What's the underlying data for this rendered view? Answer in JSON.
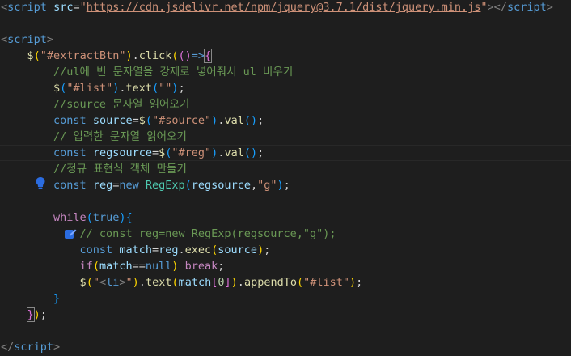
{
  "editor": {
    "theme_colors": {
      "background": "#1e1e1e",
      "keyword": "#569cd6",
      "string": "#ce9178",
      "comment": "#6a9955",
      "function": "#dcdcaa",
      "variable": "#9cdcfe",
      "control": "#c586c0",
      "class": "#4ec9b0"
    },
    "icons": [
      "lightbulb-icon",
      "edit-hint-icon"
    ],
    "lines": [
      [
        {
          "c": "t-punc",
          "t": "<"
        },
        {
          "c": "t-tag",
          "t": "script"
        },
        {
          "c": "t-plain",
          "t": " "
        },
        {
          "c": "t-attr",
          "t": "src"
        },
        {
          "c": "t-plain",
          "t": "="
        },
        {
          "c": "t-str",
          "t": "\""
        },
        {
          "c": "t-url",
          "t": "https://cdn.jsdelivr.net/npm/jquery@3.7.1/dist/jquery.min.js"
        },
        {
          "c": "t-str",
          "t": "\""
        },
        {
          "c": "t-punc",
          "t": "></"
        },
        {
          "c": "t-tag",
          "t": "script"
        },
        {
          "c": "t-punc",
          "t": ">"
        }
      ],
      [],
      [
        {
          "c": "t-punc",
          "t": "<"
        },
        {
          "c": "t-tag",
          "t": "script"
        },
        {
          "c": "t-punc",
          "t": ">"
        }
      ],
      [
        {
          "c": "t-plain",
          "t": "    "
        },
        {
          "c": "t-fn",
          "t": "$"
        },
        {
          "c": "t-b1",
          "t": "("
        },
        {
          "c": "t-str",
          "t": "\"#extractBtn\""
        },
        {
          "c": "t-b1",
          "t": ")"
        },
        {
          "c": "t-plain",
          "t": "."
        },
        {
          "c": "t-fn",
          "t": "click"
        },
        {
          "c": "t-b1",
          "t": "("
        },
        {
          "c": "t-b2",
          "t": "()"
        },
        {
          "c": "t-kw",
          "t": "=>"
        },
        {
          "c": "t-b2 bm",
          "t": "{"
        }
      ],
      [
        {
          "c": "t-plain",
          "t": "        "
        },
        {
          "c": "t-cmt",
          "t": "//ul에 빈 문자열을 강제로 넣어줘서 ul 비우기"
        }
      ],
      [
        {
          "c": "t-plain",
          "t": "        "
        },
        {
          "c": "t-fn",
          "t": "$"
        },
        {
          "c": "t-b3",
          "t": "("
        },
        {
          "c": "t-str",
          "t": "\"#list\""
        },
        {
          "c": "t-b3",
          "t": ")"
        },
        {
          "c": "t-plain",
          "t": "."
        },
        {
          "c": "t-fn",
          "t": "text"
        },
        {
          "c": "t-b3",
          "t": "("
        },
        {
          "c": "t-str",
          "t": "\"\""
        },
        {
          "c": "t-b3",
          "t": ")"
        },
        {
          "c": "t-plain",
          "t": ";"
        }
      ],
      [
        {
          "c": "t-plain",
          "t": "        "
        },
        {
          "c": "t-cmt",
          "t": "//source 문자열 읽어오기"
        }
      ],
      [
        {
          "c": "t-plain",
          "t": "        "
        },
        {
          "c": "t-kw",
          "t": "const"
        },
        {
          "c": "t-plain",
          "t": " "
        },
        {
          "c": "t-var",
          "t": "source"
        },
        {
          "c": "t-plain",
          "t": "="
        },
        {
          "c": "t-fn",
          "t": "$"
        },
        {
          "c": "t-b3",
          "t": "("
        },
        {
          "c": "t-str",
          "t": "\"#source\""
        },
        {
          "c": "t-b3",
          "t": ")"
        },
        {
          "c": "t-plain",
          "t": "."
        },
        {
          "c": "t-fn",
          "t": "val"
        },
        {
          "c": "t-b3",
          "t": "()"
        },
        {
          "c": "t-plain",
          "t": ";"
        }
      ],
      [
        {
          "c": "t-plain",
          "t": "        "
        },
        {
          "c": "t-cmt",
          "t": "// 입력한 문자열 읽어오기"
        }
      ],
      [
        {
          "c": "t-plain",
          "t": "        "
        },
        {
          "c": "t-kw",
          "t": "const"
        },
        {
          "c": "t-plain",
          "t": " "
        },
        {
          "c": "t-var",
          "t": "regsource"
        },
        {
          "c": "t-plain",
          "t": "="
        },
        {
          "c": "t-fn",
          "t": "$"
        },
        {
          "c": "t-b3",
          "t": "("
        },
        {
          "c": "t-str",
          "t": "\"#reg\""
        },
        {
          "c": "t-b3",
          "t": ")"
        },
        {
          "c": "t-plain",
          "t": "."
        },
        {
          "c": "t-fn",
          "t": "val"
        },
        {
          "c": "t-b3",
          "t": "()"
        },
        {
          "c": "t-plain",
          "t": ";"
        }
      ],
      [
        {
          "c": "t-plain",
          "t": "        "
        },
        {
          "c": "t-cmt",
          "t": "//정규 표현식 객체 만들기"
        }
      ],
      [
        {
          "c": "t-plain",
          "t": "        "
        },
        {
          "c": "t-kw",
          "t": "const"
        },
        {
          "c": "t-plain",
          "t": " "
        },
        {
          "c": "t-var",
          "t": "reg"
        },
        {
          "c": "t-plain",
          "t": "="
        },
        {
          "c": "t-kw",
          "t": "new"
        },
        {
          "c": "t-plain",
          "t": " "
        },
        {
          "c": "t-cls",
          "t": "RegExp"
        },
        {
          "c": "t-b3",
          "t": "("
        },
        {
          "c": "t-var",
          "t": "regsource"
        },
        {
          "c": "t-plain",
          "t": ","
        },
        {
          "c": "t-str",
          "t": "\"g\""
        },
        {
          "c": "t-b3",
          "t": ")"
        },
        {
          "c": "t-plain",
          "t": ";"
        }
      ],
      [],
      [
        {
          "c": "t-plain",
          "t": "        "
        },
        {
          "c": "t-ctl",
          "t": "while"
        },
        {
          "c": "t-b3",
          "t": "("
        },
        {
          "c": "t-kw",
          "t": "true"
        },
        {
          "c": "t-b3",
          "t": ")"
        },
        {
          "c": "t-b3",
          "t": "{"
        }
      ],
      [
        {
          "c": "t-plain",
          "t": "            "
        },
        {
          "c": "t-cmt",
          "t": "// const reg=new RegExp(regsource,\"g\");"
        }
      ],
      [
        {
          "c": "t-plain",
          "t": "            "
        },
        {
          "c": "t-kw",
          "t": "const"
        },
        {
          "c": "t-plain",
          "t": " "
        },
        {
          "c": "t-var",
          "t": "match"
        },
        {
          "c": "t-plain",
          "t": "="
        },
        {
          "c": "t-var",
          "t": "reg"
        },
        {
          "c": "t-plain",
          "t": "."
        },
        {
          "c": "t-fn",
          "t": "exec"
        },
        {
          "c": "t-b1",
          "t": "("
        },
        {
          "c": "t-var",
          "t": "source"
        },
        {
          "c": "t-b1",
          "t": ")"
        },
        {
          "c": "t-plain",
          "t": ";"
        }
      ],
      [
        {
          "c": "t-plain",
          "t": "            "
        },
        {
          "c": "t-ctl",
          "t": "if"
        },
        {
          "c": "t-b1",
          "t": "("
        },
        {
          "c": "t-var",
          "t": "match"
        },
        {
          "c": "t-plain",
          "t": "=="
        },
        {
          "c": "t-kw",
          "t": "null"
        },
        {
          "c": "t-b1",
          "t": ")"
        },
        {
          "c": "t-plain",
          "t": " "
        },
        {
          "c": "t-ctl",
          "t": "break"
        },
        {
          "c": "t-plain",
          "t": ";"
        }
      ],
      [
        {
          "c": "t-plain",
          "t": "            "
        },
        {
          "c": "t-fn",
          "t": "$"
        },
        {
          "c": "t-b1",
          "t": "("
        },
        {
          "c": "t-str",
          "t": "\""
        },
        {
          "c": "t-punc",
          "t": "<"
        },
        {
          "c": "t-tag",
          "t": "li"
        },
        {
          "c": "t-punc",
          "t": ">"
        },
        {
          "c": "t-str",
          "t": "\""
        },
        {
          "c": "t-b1",
          "t": ")"
        },
        {
          "c": "t-plain",
          "t": "."
        },
        {
          "c": "t-fn",
          "t": "text"
        },
        {
          "c": "t-b1",
          "t": "("
        },
        {
          "c": "t-var",
          "t": "match"
        },
        {
          "c": "t-b2",
          "t": "["
        },
        {
          "c": "t-num",
          "t": "0"
        },
        {
          "c": "t-b2",
          "t": "]"
        },
        {
          "c": "t-b1",
          "t": ")"
        },
        {
          "c": "t-plain",
          "t": "."
        },
        {
          "c": "t-fn",
          "t": "appendTo"
        },
        {
          "c": "t-b1",
          "t": "("
        },
        {
          "c": "t-str",
          "t": "\"#list\""
        },
        {
          "c": "t-b1",
          "t": ")"
        },
        {
          "c": "t-plain",
          "t": ";"
        }
      ],
      [
        {
          "c": "t-plain",
          "t": "        "
        },
        {
          "c": "t-b3",
          "t": "}"
        }
      ],
      [
        {
          "c": "t-plain",
          "t": "    "
        },
        {
          "c": "t-b2 bm",
          "t": "}"
        },
        {
          "c": "t-b1",
          "t": ")"
        },
        {
          "c": "t-plain",
          "t": ";"
        }
      ],
      [],
      [
        {
          "c": "t-punc",
          "t": "</"
        },
        {
          "c": "t-tag",
          "t": "script"
        },
        {
          "c": "t-punc",
          "t": ">"
        }
      ]
    ]
  }
}
